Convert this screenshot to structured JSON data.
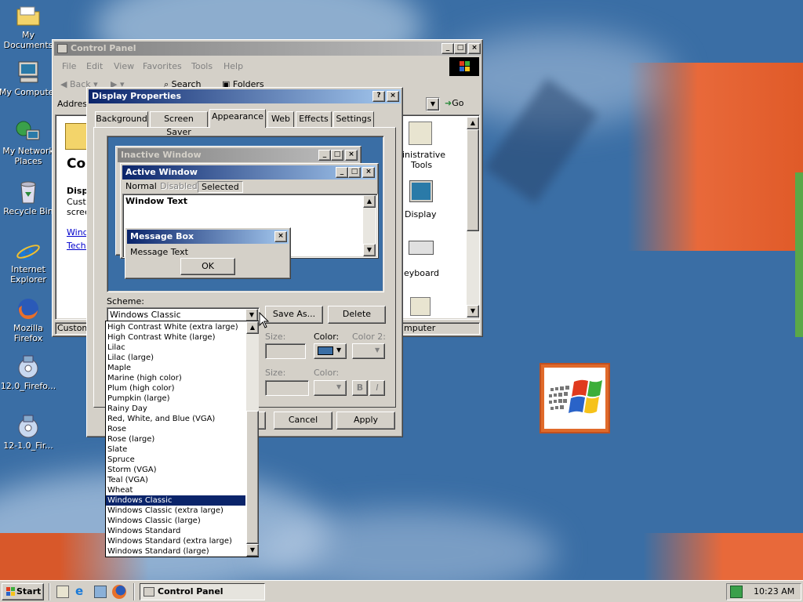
{
  "desktop": {
    "icons": [
      {
        "label": "My Documents",
        "icon": "folder-icon"
      },
      {
        "label": "My Computer",
        "icon": "computer-icon"
      },
      {
        "label": "My Network Places",
        "icon": "network-icon"
      },
      {
        "label": "Recycle Bin",
        "icon": "recycle-bin-icon"
      },
      {
        "label": "Internet Explorer",
        "icon": "ie-icon"
      },
      {
        "label": "Mozilla Firefox",
        "icon": "firefox-icon"
      },
      {
        "label": "12.0_Firefo...",
        "icon": "installer-icon"
      },
      {
        "label": "12-1.0_Fir...",
        "icon": "installer-icon"
      }
    ]
  },
  "control_panel": {
    "title": "Control Panel",
    "menu": [
      "File",
      "Edit",
      "View",
      "Favorites",
      "Tools",
      "Help"
    ],
    "toolbar": {
      "back": "Back",
      "search": "Search",
      "folders": "Folders"
    },
    "address_label": "Address",
    "go_label": "Go",
    "left_heading": "Cor",
    "left_desc": [
      "Displ",
      "Custo",
      "scree"
    ],
    "links": [
      "Windo",
      "Techr"
    ],
    "right_items": [
      "inistrative",
      "Tools",
      "Display",
      "eyboard"
    ],
    "status_left": "Customi",
    "status_right": "mputer"
  },
  "display_properties": {
    "title": "Display Properties",
    "tabs": [
      "Background",
      "Screen Saver",
      "Appearance",
      "Web",
      "Effects",
      "Settings"
    ],
    "active_tab": "Appearance",
    "preview": {
      "inactive_title": "Inactive Window",
      "active_title": "Active Window",
      "menu_normal": "Normal",
      "menu_disabled": "Disabled",
      "menu_selected": "Selected",
      "window_text": "Window Text",
      "msgbox_title": "Message Box",
      "msgbox_text": "Message Text",
      "ok": "OK"
    },
    "scheme_label": "Scheme:",
    "scheme_value": "Windows Classic",
    "save_as": "Save As...",
    "delete": "Delete",
    "size_label": "Size:",
    "color_label": "Color:",
    "color2_label": "Color 2:",
    "size2_label": "Size:",
    "color3_label": "Color:",
    "bold": "B",
    "italic": "I",
    "cancel": "Cancel",
    "apply": "Apply",
    "accent_color": "#3a6ea5",
    "scheme_options": [
      "High Contrast White (extra large)",
      "High Contrast White (large)",
      "Lilac",
      "Lilac (large)",
      "Maple",
      "Marine (high color)",
      "Plum (high color)",
      "Pumpkin (large)",
      "Rainy Day",
      "Red, White, and Blue (VGA)",
      "Rose",
      "Rose (large)",
      "Slate",
      "Spruce",
      "Storm (VGA)",
      "Teal (VGA)",
      "Wheat",
      "Windows Classic",
      "Windows Classic (extra large)",
      "Windows Classic (large)",
      "Windows Standard",
      "Windows Standard (extra large)",
      "Windows Standard (large)"
    ],
    "selected_option": "Windows Classic"
  },
  "taskbar": {
    "start": "Start",
    "task": "Control Panel",
    "clock": "10:23 AM"
  }
}
